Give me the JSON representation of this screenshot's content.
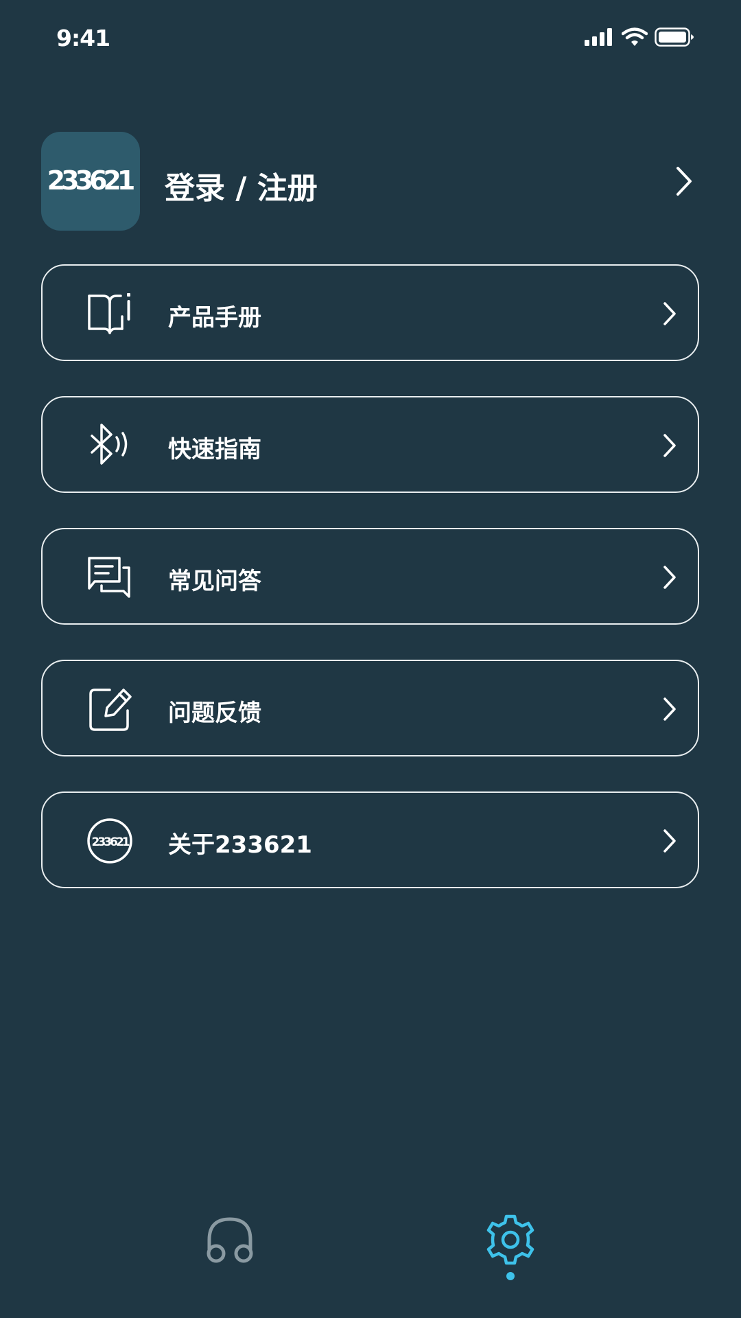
{
  "status_bar": {
    "time": "9:41"
  },
  "profile": {
    "logo_text": "233621",
    "label": "登录 / 注册"
  },
  "menu": [
    {
      "label": "产品手册",
      "icon": "book-icon"
    },
    {
      "label": "快速指南",
      "icon": "bluetooth-icon"
    },
    {
      "label": "常见问答",
      "icon": "chat-icon"
    },
    {
      "label": "问题反馈",
      "icon": "edit-icon"
    },
    {
      "label": "关于233621",
      "icon": "brand-logo-icon",
      "logo_text": "233621"
    }
  ],
  "bottom_nav": {
    "items": [
      {
        "icon": "headphones-icon",
        "active": false
      },
      {
        "icon": "gear-icon",
        "active": true
      }
    ]
  },
  "colors": {
    "background": "#1f3744",
    "logo_tile": "#2e5b6c",
    "card_border": "#e9eef0",
    "accent": "#3ec2ea",
    "inactive_icon": "#8a9aa2"
  }
}
